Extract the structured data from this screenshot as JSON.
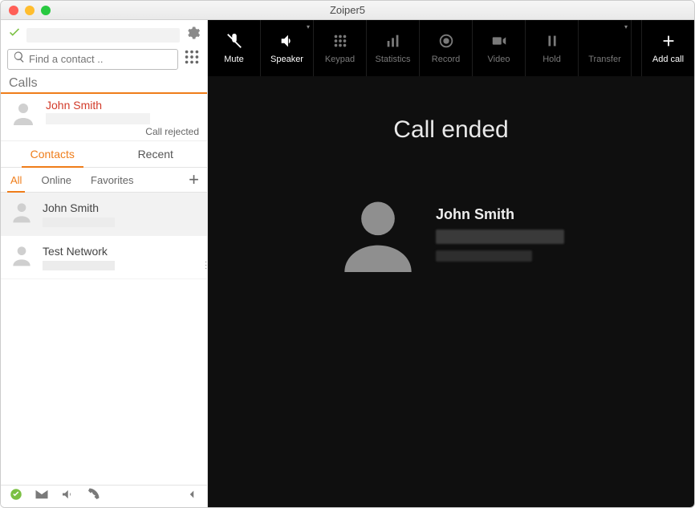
{
  "window": {
    "title": "Zoiper5"
  },
  "search": {
    "placeholder": "Find a contact .."
  },
  "calls_section": {
    "header": "Calls",
    "item": {
      "name": "John Smith",
      "status": "Call rejected"
    }
  },
  "tabs_cr": {
    "contacts": "Contacts",
    "recent": "Recent"
  },
  "filters": {
    "all": "All",
    "online": "Online",
    "favorites": "Favorites"
  },
  "contacts": [
    {
      "name": "John Smith"
    },
    {
      "name": "Test Network"
    }
  ],
  "toolbar": {
    "mute": "Mute",
    "speaker": "Speaker",
    "keypad": "Keypad",
    "statistics": "Statistics",
    "record": "Record",
    "video": "Video",
    "hold": "Hold",
    "transfer": "Transfer",
    "add_call": "Add call"
  },
  "call_panel": {
    "status": "Call ended",
    "caller_name": "John Smith"
  }
}
